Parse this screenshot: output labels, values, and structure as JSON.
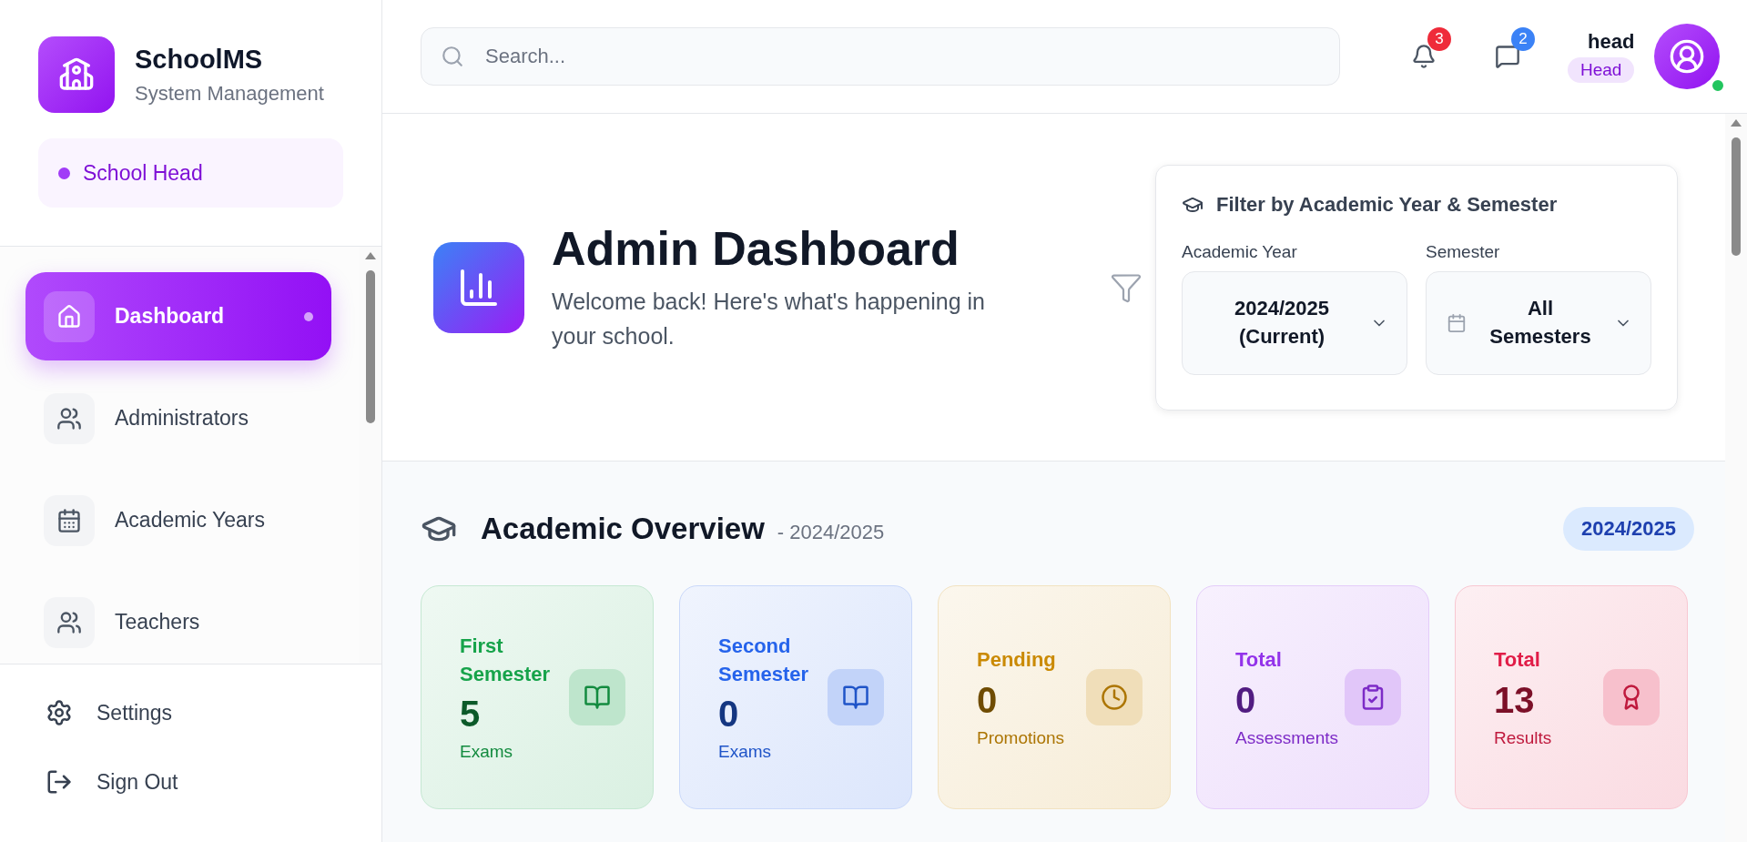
{
  "brand": {
    "name": "SchoolMS",
    "subtitle": "System Management"
  },
  "role": {
    "label": "School Head"
  },
  "nav": [
    {
      "label": "Dashboard",
      "selected": true
    },
    {
      "label": "Administrators",
      "selected": false
    },
    {
      "label": "Academic Years",
      "selected": false
    },
    {
      "label": "Teachers",
      "selected": false
    }
  ],
  "footer_nav": [
    {
      "label": "Settings"
    },
    {
      "label": "Sign Out"
    }
  ],
  "search": {
    "placeholder": "Search..."
  },
  "notifications": {
    "count": "3"
  },
  "messages": {
    "count": "2"
  },
  "user": {
    "name": "head",
    "role": "Head",
    "online": true
  },
  "page": {
    "title": "Admin Dashboard",
    "subtitle": "Welcome back! Here's what's happening in your school."
  },
  "filter": {
    "title": "Filter by Academic Year & Semester",
    "fields": [
      {
        "label": "Academic Year",
        "value": "2024/2025 (Current)"
      },
      {
        "label": "Semester",
        "value": "All Semesters"
      }
    ]
  },
  "overview": {
    "title": "Academic Overview",
    "subtitle": "- 2024/2025",
    "badge": "2024/2025",
    "cards": [
      {
        "title": "First Semester",
        "value": "5",
        "caption": "Exams",
        "color": "#16a34a"
      },
      {
        "title": "Second Semester",
        "value": "0",
        "caption": "Exams",
        "color": "#2563eb"
      },
      {
        "title": "Pending",
        "value": "0",
        "caption": "Promotions",
        "color": "#ca8a04"
      },
      {
        "title": "Total",
        "value": "0",
        "caption": "Assessments",
        "color": "#9333ea"
      },
      {
        "title": "Total",
        "value": "13",
        "caption": "Results",
        "color": "#e11d48"
      }
    ]
  }
}
